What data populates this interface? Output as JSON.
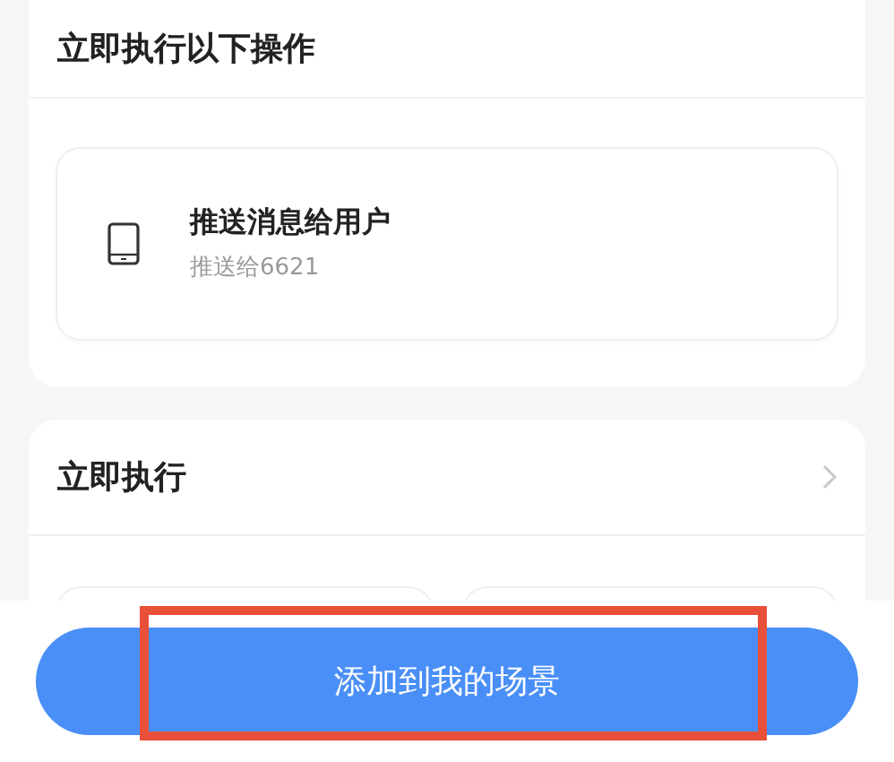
{
  "sections": [
    {
      "title": "立即执行以下操作",
      "chevron": false,
      "actions": [
        {
          "title": "推送消息给用户",
          "subtitle": "推送给6621"
        }
      ]
    },
    {
      "title": "立即执行",
      "chevron": true
    }
  ],
  "primary_button": {
    "label": "添加到我的场景"
  },
  "annotation": {
    "kind": "rectangle",
    "color": "#e8503a"
  }
}
